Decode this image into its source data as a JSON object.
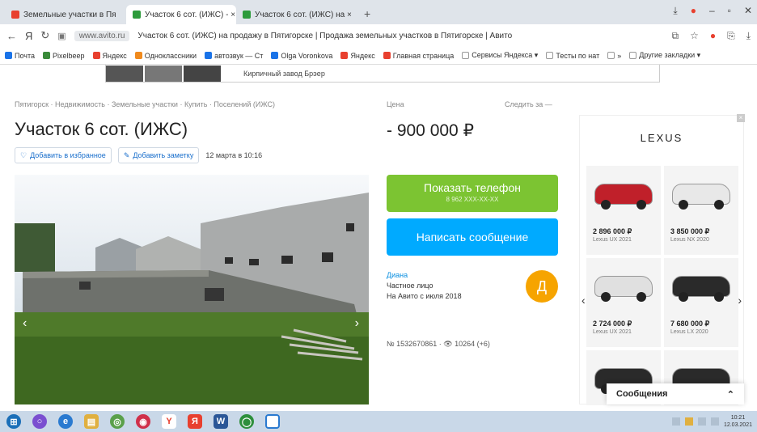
{
  "browser": {
    "tabs": [
      {
        "label": "Земельные участки в Пя",
        "color": "#e8402f",
        "active": false
      },
      {
        "label": "Участок 6 сот. (ИЖС) - ×",
        "color": "#2d9b3c",
        "active": true
      },
      {
        "label": "Участок 6 сот. (ИЖС) на ×",
        "color": "#2d9b3c",
        "active": false
      }
    ],
    "new_tab": "+",
    "domain": "www.avito.ru",
    "page_title": "Участок 6 сот. (ИЖС) на продажу в Пятигорске | Продажа земельных участков в Пятигорске | Авито",
    "bookmarks": [
      {
        "label": "Почта",
        "color": "#1a73e8"
      },
      {
        "label": "Pixelbeep",
        "color": "#3a8b3a"
      },
      {
        "label": "Яндекс",
        "color": "#e8402f"
      },
      {
        "label": "Одноклассники",
        "color": "#f08a1d"
      },
      {
        "label": "автозвук — Ст",
        "color": "#1a73e8"
      },
      {
        "label": "Olga Voronkova",
        "color": "#1a73e8"
      },
      {
        "label": "Яндекс",
        "color": "#e8402f"
      },
      {
        "label": "Главная страница",
        "color": "#e8402f"
      },
      {
        "label": "Сервисы Яндекса ▾",
        "color": "#ffffff"
      },
      {
        "label": "Тесты по нат",
        "color": "#ffffff"
      },
      {
        "label": "»",
        "color": "#ffffff"
      },
      {
        "label": "Другие закладки ▾",
        "color": "#ffffff"
      }
    ],
    "dropdown_text": "Кирпичный завод Брэер"
  },
  "listing": {
    "breadcrumbs": "Пятигорск · Недвижимость · Земельные участки · Купить · Поселений (ИЖС)",
    "title": "Участок 6 сот. (ИЖС)",
    "favorite_label": "Добавить в избранное",
    "note_label": "Добавить заметку",
    "date": "12 марта в 10:16",
    "price_label": "Цена",
    "compare_label": "Следить за —",
    "price": "- 900 000 ₽",
    "phone_button": "Показать телефон",
    "phone_sub": "8 962 XXX-XX-XX",
    "message_button": "Написать сообщение",
    "seller_name": "Диана",
    "seller_type": "Частное лицо",
    "seller_since": "На Авито с июля 2018",
    "avatar_letter": "Д",
    "ad_number": "№ 1532670861 · 👁 10264 (+6)"
  },
  "ad": {
    "brand": "LEXUS",
    "cars": [
      {
        "price": "2 896 000 ₽",
        "model": "Lexus UX 2021",
        "color": "#c0202a"
      },
      {
        "price": "3 850 000 ₽",
        "model": "Lexus NX 2020",
        "color": "#e8e8e8"
      },
      {
        "price": "2 724 000 ₽",
        "model": "Lexus UX 2021",
        "color": "#e0e0e0"
      },
      {
        "price": "7 680 000 ₽",
        "model": "Lexus LX 2020",
        "color": "#2a2a2a"
      },
      {
        "price": "",
        "model": "",
        "color": "#2a2a2a"
      },
      {
        "price": "",
        "model": "",
        "color": "#2a2a2a"
      }
    ]
  },
  "chat": {
    "label": "Сообщения"
  },
  "taskbar": {
    "time": "10:21",
    "date": "12.03.2021"
  }
}
